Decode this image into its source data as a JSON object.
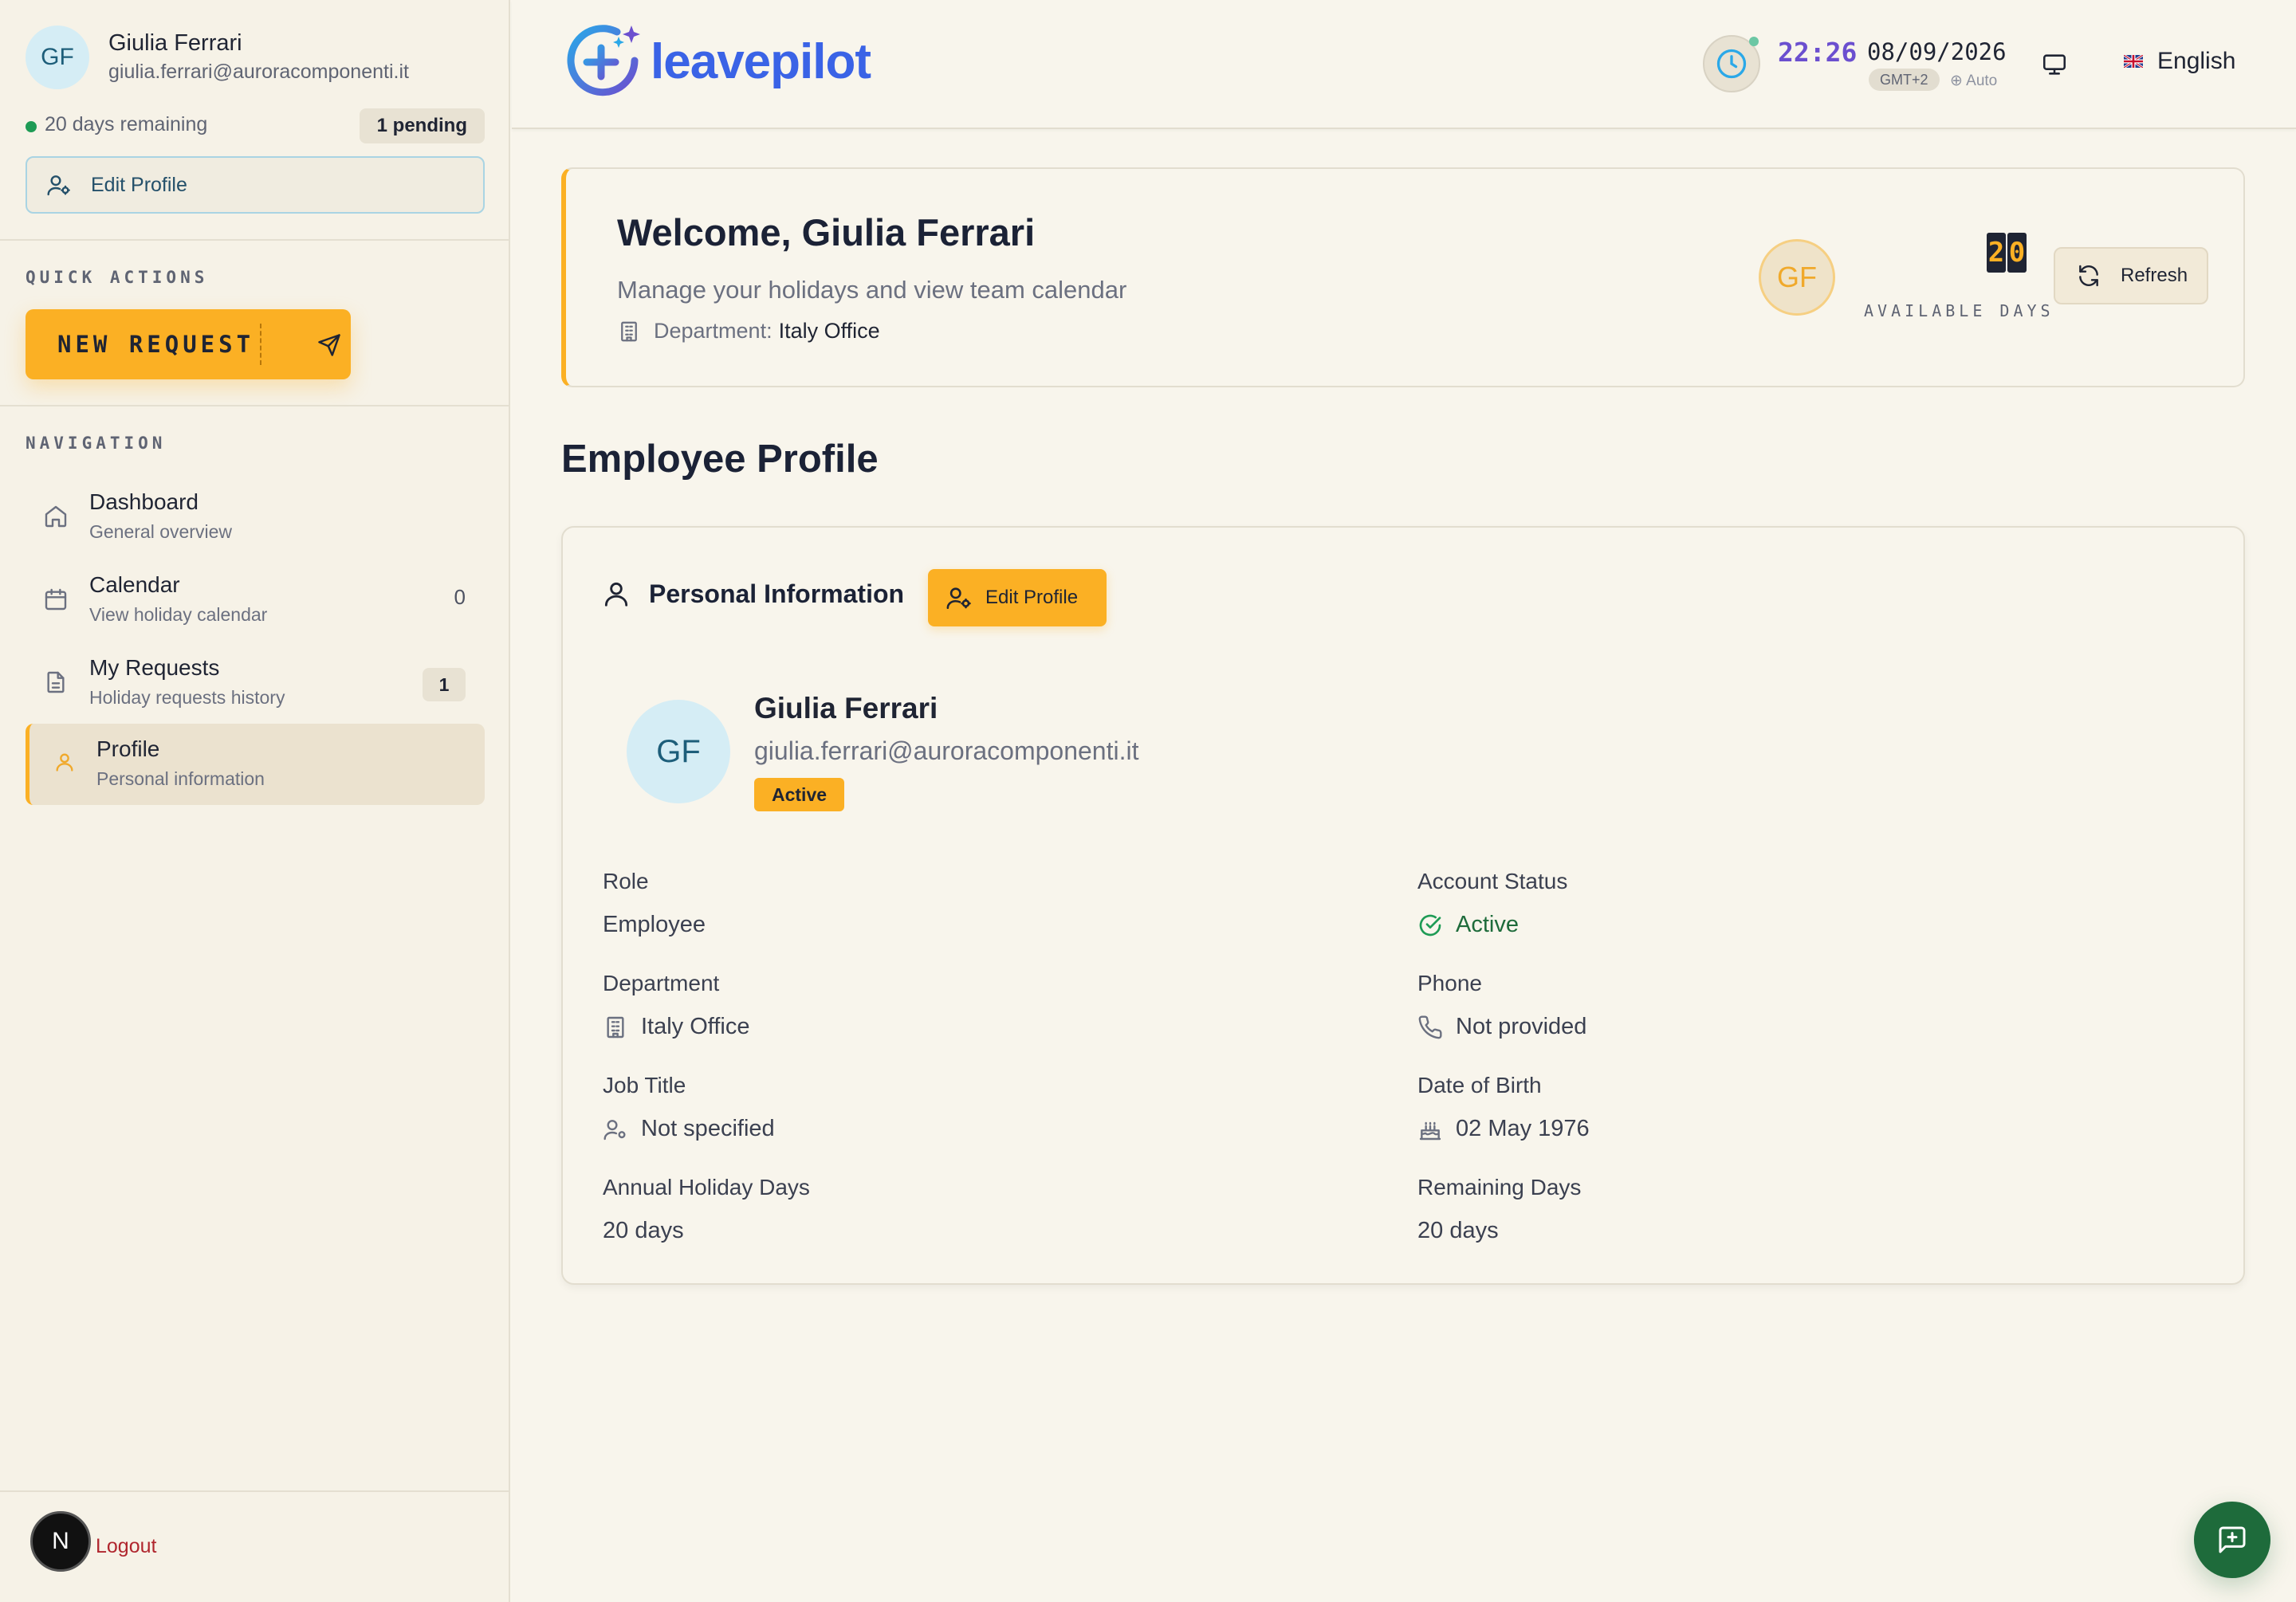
{
  "user": {
    "initials": "GF",
    "name": "Giulia Ferrari",
    "email": "giulia.ferrari@auroracomponenti.it",
    "days_remaining": "20 days remaining",
    "pending": "1 pending",
    "edit_profile_label": "Edit Profile"
  },
  "sidebar": {
    "quick_actions_label": "QUICK ACTIONS",
    "new_request_label": "NEW REQUEST",
    "navigation_label": "NAVIGATION",
    "items": [
      {
        "title": "Dashboard",
        "subtitle": "General overview",
        "icon": "home-icon"
      },
      {
        "title": "Calendar",
        "subtitle": "View holiday calendar",
        "count": "0",
        "icon": "calendar-icon"
      },
      {
        "title": "My Requests",
        "subtitle": "Holiday requests history",
        "badge": "1",
        "icon": "document-icon"
      },
      {
        "title": "Profile",
        "subtitle": "Personal information",
        "icon": "user-icon",
        "active": true
      }
    ],
    "logout_avatar": "N",
    "logout_label": "Logout"
  },
  "topbar": {
    "logo_text": "leavepilot",
    "time": "22:26",
    "date": "08/09/2026",
    "timezone": "GMT+2",
    "tz_mode": "⊕ Auto",
    "language": "English"
  },
  "welcome": {
    "title": "Welcome, Giulia Ferrari",
    "subtitle": "Manage your holidays and view team calendar",
    "department_label": "Department:",
    "department_value": "Italy Office",
    "avatar_initials": "GF",
    "available_digit_1": "2",
    "available_digit_2": "0",
    "available_label": "AVAILABLE DAYS",
    "refresh_label": "Refresh"
  },
  "profile": {
    "page_title": "Employee Profile",
    "section_title": "Personal Information",
    "edit_button": "Edit Profile",
    "initials": "GF",
    "name": "Giulia Ferrari",
    "email": "giulia.ferrari@auroracomponenti.it",
    "status_pill": "Active",
    "fields": {
      "role_label": "Role",
      "role_value": "Employee",
      "account_status_label": "Account Status",
      "account_status_value": "Active",
      "department_label": "Department",
      "department_value": "Italy Office",
      "phone_label": "Phone",
      "phone_value": "Not provided",
      "job_title_label": "Job Title",
      "job_title_value": "Not specified",
      "dob_label": "Date of Birth",
      "dob_value": "02 May 1976",
      "annual_label": "Annual Holiday Days",
      "annual_value": "20 days",
      "remaining_label": "Remaining Days",
      "remaining_value": "20 days"
    }
  },
  "colors": {
    "accent": "#fbb024",
    "brand": "#3a63e6",
    "success": "#1e6b3b",
    "background": "#f8f5ec"
  }
}
